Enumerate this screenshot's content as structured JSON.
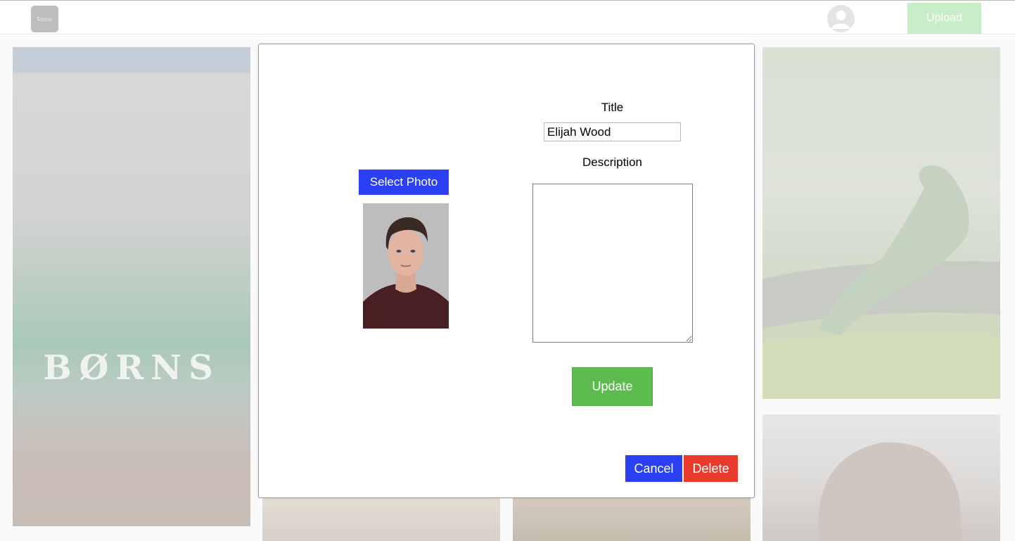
{
  "header": {
    "logo_text": "5oooo",
    "upload_label": "Upload"
  },
  "gallery": {
    "concert_band_text": "BØRNS"
  },
  "modal": {
    "select_photo_label": "Select Photo",
    "title_label": "Title",
    "title_value": "Elijah Wood",
    "description_label": "Description",
    "description_value": "",
    "update_label": "Update",
    "cancel_label": "Cancel",
    "delete_label": "Delete"
  },
  "colors": {
    "primary_blue": "#2b3ff4",
    "update_green": "#5cbd4e",
    "delete_red": "#ea3b2e",
    "upload_green_faded": "#c8edc8"
  },
  "icons": {
    "avatar": "user-avatar-icon"
  }
}
